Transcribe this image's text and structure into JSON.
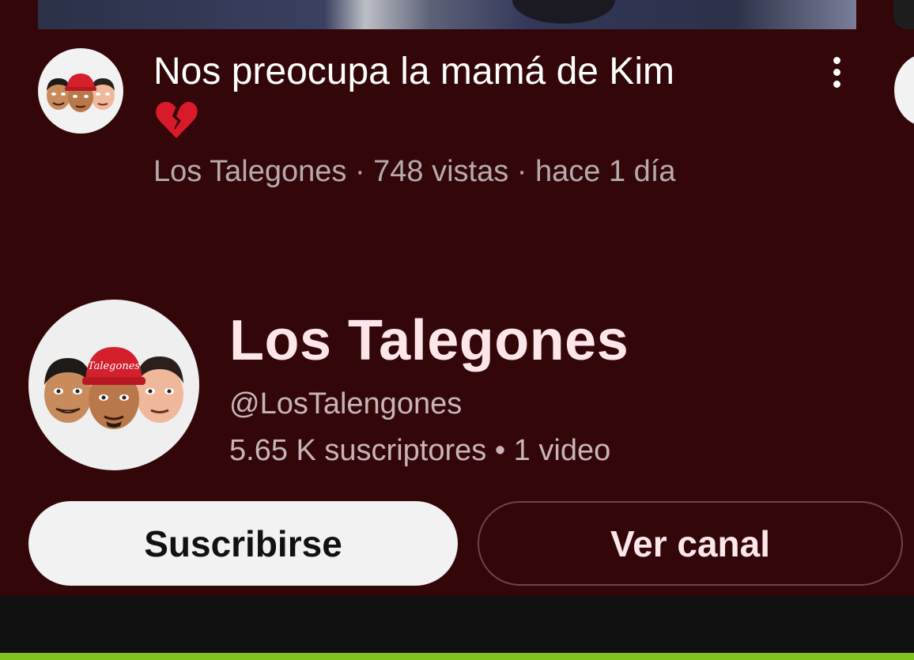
{
  "video": {
    "title": "Nos preocupa la mamá de Kim",
    "title_emoji": "broken-heart",
    "meta": "Los Talegones · 748 vistas · hace 1 día",
    "menu_icon": "more-vert-icon"
  },
  "channel": {
    "name": "Los Talegones",
    "handle": "@LosTalengones",
    "stats": "5.65 K suscriptores • 1 video",
    "avatar_text": "Talegones"
  },
  "buttons": {
    "subscribe": "Suscribirse",
    "view_channel": "Ver canal"
  },
  "colors": {
    "background": "#330609",
    "subscribe_bg": "#f2f2f2",
    "accent_green": "#7fc31c",
    "cap_red": "#d4202c"
  }
}
